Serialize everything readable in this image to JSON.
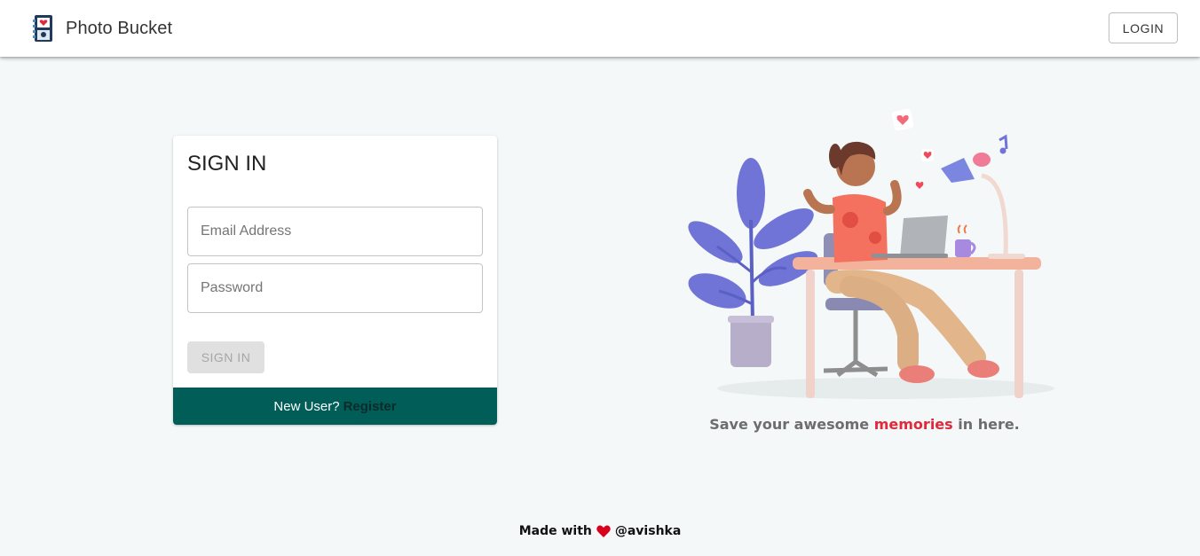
{
  "navbar": {
    "brand_title": "Photo Bucket",
    "login_label": "LOGIN"
  },
  "signin_card": {
    "title": "SIGN IN",
    "email_placeholder": "Email Address",
    "password_placeholder": "Password",
    "submit_label": "SIGN IN",
    "footer_prefix": "New User?",
    "register_label": "Register"
  },
  "hero": {
    "illustration_icon": "woman-at-desk-illustration",
    "tagline_before": "Save your awesome",
    "tagline_accent": "memories",
    "tagline_after": "in here."
  },
  "footer": {
    "made_with": "Made with",
    "author": "@avishka",
    "heart_icon": "heart-icon"
  },
  "colors": {
    "accent_red": "#e0293a",
    "card_footer_teal": "#005d57",
    "page_background": "#f4f8f8"
  }
}
